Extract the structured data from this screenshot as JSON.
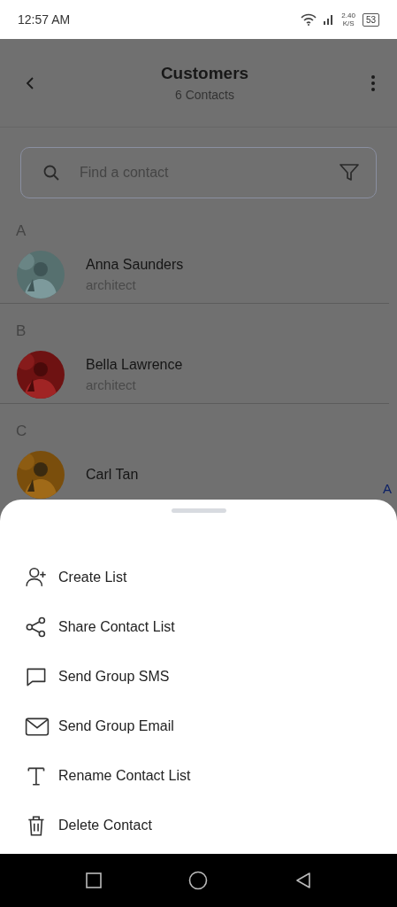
{
  "status_bar": {
    "time": "12:57 AM",
    "speed_value": "2.40",
    "speed_unit": "K/S",
    "battery": "53"
  },
  "header": {
    "title": "Customers",
    "subtitle": "6 Contacts"
  },
  "search": {
    "placeholder": "Find a contact"
  },
  "sections": [
    {
      "letter": "A",
      "contacts": [
        {
          "name": "Anna Saunders",
          "role": "architect",
          "kind": "picture"
        }
      ]
    },
    {
      "letter": "B",
      "contacts": [
        {
          "name": "Bella Lawrence",
          "role": "architect",
          "kind": "picture"
        }
      ]
    },
    {
      "letter": "C",
      "contacts": [
        {
          "name": "Carl Tan",
          "kind": "picture"
        }
      ]
    }
  ],
  "index_letters": [
    "A"
  ],
  "sheet": {
    "items": [
      {
        "label": "Create List",
        "kind": "person-add"
      },
      {
        "label": "Share Contact List",
        "kind": "share"
      },
      {
        "label": "Send Group SMS",
        "kind": "chat"
      },
      {
        "label": "Send Group Email",
        "kind": "mail"
      },
      {
        "label": "Rename Contact List",
        "kind": "text"
      },
      {
        "label": "Delete Contact",
        "kind": "trash"
      }
    ]
  }
}
